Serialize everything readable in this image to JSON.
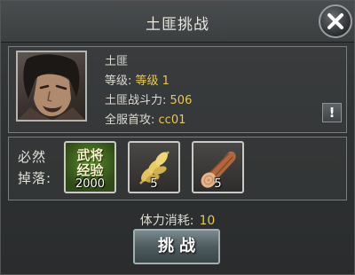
{
  "dialog": {
    "title": "土匪挑战",
    "close_icon": "close-icon"
  },
  "enemy": {
    "name": "土匪",
    "level_label": "等级:",
    "level_value": "等级 1",
    "power_label": "土匪战斗力:",
    "power_value": "506",
    "first_label": "全服首攻:",
    "first_value": "cc01",
    "info_button": "!"
  },
  "drops": {
    "label_line1": "必然",
    "label_line2": "掉落:",
    "items": [
      {
        "name": "exp-item",
        "text_line1": "武将",
        "text_line2": "经验",
        "count": "2000"
      },
      {
        "name": "wheat-item",
        "icon": "wheat-icon",
        "count": "5"
      },
      {
        "name": "wood-item",
        "icon": "wood-log-icon",
        "count": "5"
      }
    ]
  },
  "cost": {
    "label": "体力消耗:",
    "value": "10"
  },
  "actions": {
    "challenge_label": "挑战"
  },
  "colors": {
    "value_gold": "#e9c84a",
    "text_light": "#dcdad3",
    "panel_bg": "#2f3233"
  }
}
